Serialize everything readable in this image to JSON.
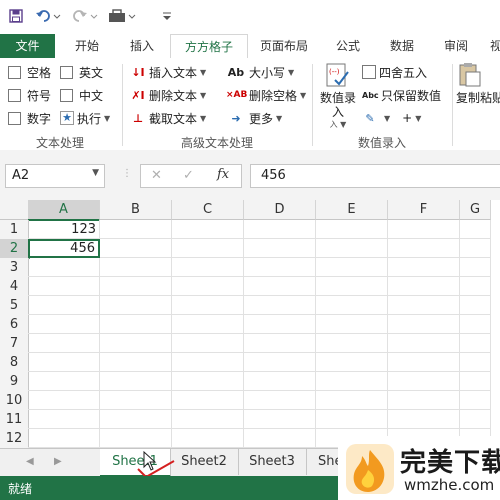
{
  "colors": {
    "accent": "#217346",
    "selection": "#217346",
    "watermark_text": "#1a1a1a",
    "watermark_logo": "#f29a1f"
  },
  "quick_access": {
    "icons": [
      "save-icon",
      "undo-icon",
      "redo-icon",
      "tools-icon",
      "customize-icon"
    ]
  },
  "ribbon_tabs": [
    {
      "label": "文件",
      "state": "file"
    },
    {
      "label": "开始"
    },
    {
      "label": "插入"
    },
    {
      "label": "方方格子",
      "state": "active"
    },
    {
      "label": "页面布局"
    },
    {
      "label": "公式"
    },
    {
      "label": "数据"
    },
    {
      "label": "审阅"
    },
    {
      "label": "视"
    }
  ],
  "ribbon": {
    "text_processing": {
      "label": "文本处理",
      "checkboxes": [
        "空格",
        "英文",
        "符号",
        "中文",
        "数字"
      ],
      "execute": "执行"
    },
    "advanced_text": {
      "label": "高级文本处理",
      "items": [
        "插入文本",
        "删除文本",
        "截取文本",
        "大小写",
        "删除空格",
        "更多"
      ]
    },
    "number_entry": {
      "label": "数值录入",
      "big_button": "数值录入",
      "items": [
        "四舍五入",
        "只保留数值"
      ]
    },
    "copy_paste": {
      "label": "复制粘贴"
    }
  },
  "formula_bar": {
    "name_box": "A2",
    "fx": "fx",
    "value": "456"
  },
  "grid": {
    "columns": [
      "A",
      "B",
      "C",
      "D",
      "E",
      "F",
      "G"
    ],
    "rows": [
      "1",
      "2",
      "3",
      "4",
      "5",
      "6",
      "7",
      "8",
      "9",
      "10",
      "11",
      "12"
    ],
    "cells": {
      "A1": "123",
      "A2": "456"
    },
    "selected": "A2"
  },
  "sheet_tabs": [
    "Sheet1",
    "Sheet2",
    "Sheet3",
    "She"
  ],
  "status": {
    "text": "就绪"
  },
  "watermark": {
    "title": "完美下载",
    "url": "wmzhe.com"
  }
}
